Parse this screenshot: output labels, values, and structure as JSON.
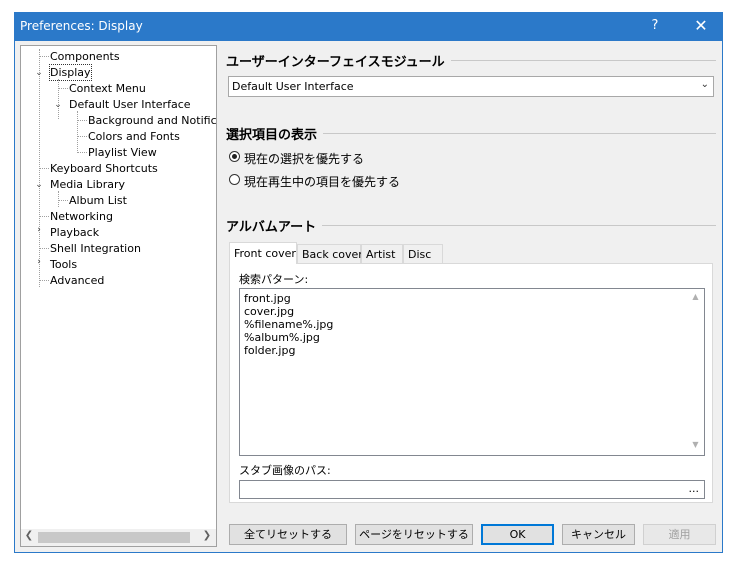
{
  "window": {
    "title": "Preferences: Display",
    "help_label": "?",
    "close_label": "✕"
  },
  "tree": {
    "items": [
      {
        "label": "Components"
      },
      {
        "label": "Display"
      },
      {
        "label": "Context Menu"
      },
      {
        "label": "Default User Interface"
      },
      {
        "label": "Background and Notifications"
      },
      {
        "label": "Colors and Fonts"
      },
      {
        "label": "Playlist View"
      },
      {
        "label": "Keyboard Shortcuts"
      },
      {
        "label": "Media Library"
      },
      {
        "label": "Album List"
      },
      {
        "label": "Networking"
      },
      {
        "label": "Playback"
      },
      {
        "label": "Shell Integration"
      },
      {
        "label": "Tools"
      },
      {
        "label": "Advanced"
      }
    ]
  },
  "ui_module": {
    "header": "ユーザーインターフェイスモジュール",
    "selected": "Default User Interface"
  },
  "selection": {
    "header": "選択項目の表示",
    "options": [
      {
        "label": "現在の選択を優先する",
        "checked": true
      },
      {
        "label": "現在再生中の項目を優先する",
        "checked": false
      }
    ]
  },
  "album_art": {
    "header": "アルバムアート",
    "tabs": [
      {
        "label": "Front cover"
      },
      {
        "label": "Back cover"
      },
      {
        "label": "Artist"
      },
      {
        "label": "Disc"
      }
    ],
    "search_label": "検索パターン:",
    "patterns": [
      "front.jpg",
      "cover.jpg",
      "%filename%.jpg",
      "%album%.jpg",
      "folder.jpg"
    ],
    "stub_label": "スタブ画像のパス:",
    "stub_value": "",
    "browse_label": "..."
  },
  "buttons": {
    "reset_all": "全てリセットする",
    "reset_page": "ページをリセットする",
    "ok": "OK",
    "cancel": "キャンセル",
    "apply": "適用"
  }
}
